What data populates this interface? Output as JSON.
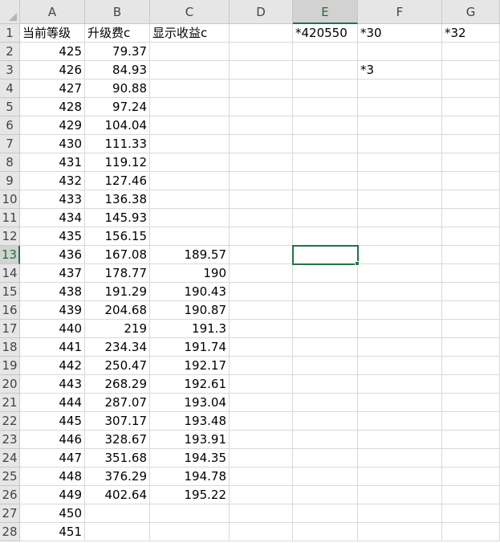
{
  "columns": [
    "A",
    "B",
    "C",
    "D",
    "E",
    "F",
    "G"
  ],
  "selected_column": "E",
  "selected_row": "13",
  "rows": [
    {
      "n": "1",
      "A": "当前等级",
      "B": "升级费c",
      "C": "显示收益c",
      "E": "*420550",
      "F": "*30",
      "G": "*32"
    },
    {
      "n": "2",
      "A": "425",
      "B": "79.37"
    },
    {
      "n": "3",
      "A": "426",
      "B": "84.93",
      "F": "*3"
    },
    {
      "n": "4",
      "A": "427",
      "B": "90.88"
    },
    {
      "n": "5",
      "A": "428",
      "B": "97.24"
    },
    {
      "n": "6",
      "A": "429",
      "B": "104.04"
    },
    {
      "n": "7",
      "A": "430",
      "B": "111.33"
    },
    {
      "n": "8",
      "A": "431",
      "B": "119.12"
    },
    {
      "n": "9",
      "A": "432",
      "B": "127.46"
    },
    {
      "n": "10",
      "A": "433",
      "B": "136.38"
    },
    {
      "n": "11",
      "A": "434",
      "B": "145.93"
    },
    {
      "n": "12",
      "A": "435",
      "B": "156.15"
    },
    {
      "n": "13",
      "A": "436",
      "B": "167.08",
      "C": "189.57"
    },
    {
      "n": "14",
      "A": "437",
      "B": "178.77",
      "C": "190"
    },
    {
      "n": "15",
      "A": "438",
      "B": "191.29",
      "C": "190.43"
    },
    {
      "n": "16",
      "A": "439",
      "B": "204.68",
      "C": "190.87"
    },
    {
      "n": "17",
      "A": "440",
      "B": "219",
      "C": "191.3"
    },
    {
      "n": "18",
      "A": "441",
      "B": "234.34",
      "C": "191.74"
    },
    {
      "n": "19",
      "A": "442",
      "B": "250.47",
      "C": "192.17"
    },
    {
      "n": "20",
      "A": "443",
      "B": "268.29",
      "C": "192.61"
    },
    {
      "n": "21",
      "A": "444",
      "B": "287.07",
      "C": "193.04"
    },
    {
      "n": "22",
      "A": "445",
      "B": "307.17",
      "C": "193.48"
    },
    {
      "n": "23",
      "A": "446",
      "B": "328.67",
      "C": "193.91"
    },
    {
      "n": "24",
      "A": "447",
      "B": "351.68",
      "C": "194.35"
    },
    {
      "n": "25",
      "A": "448",
      "B": "376.29",
      "C": "194.78"
    },
    {
      "n": "26",
      "A": "449",
      "B": "402.64",
      "C": "195.22"
    },
    {
      "n": "27",
      "A": "450"
    },
    {
      "n": "28",
      "A": "451"
    }
  ]
}
